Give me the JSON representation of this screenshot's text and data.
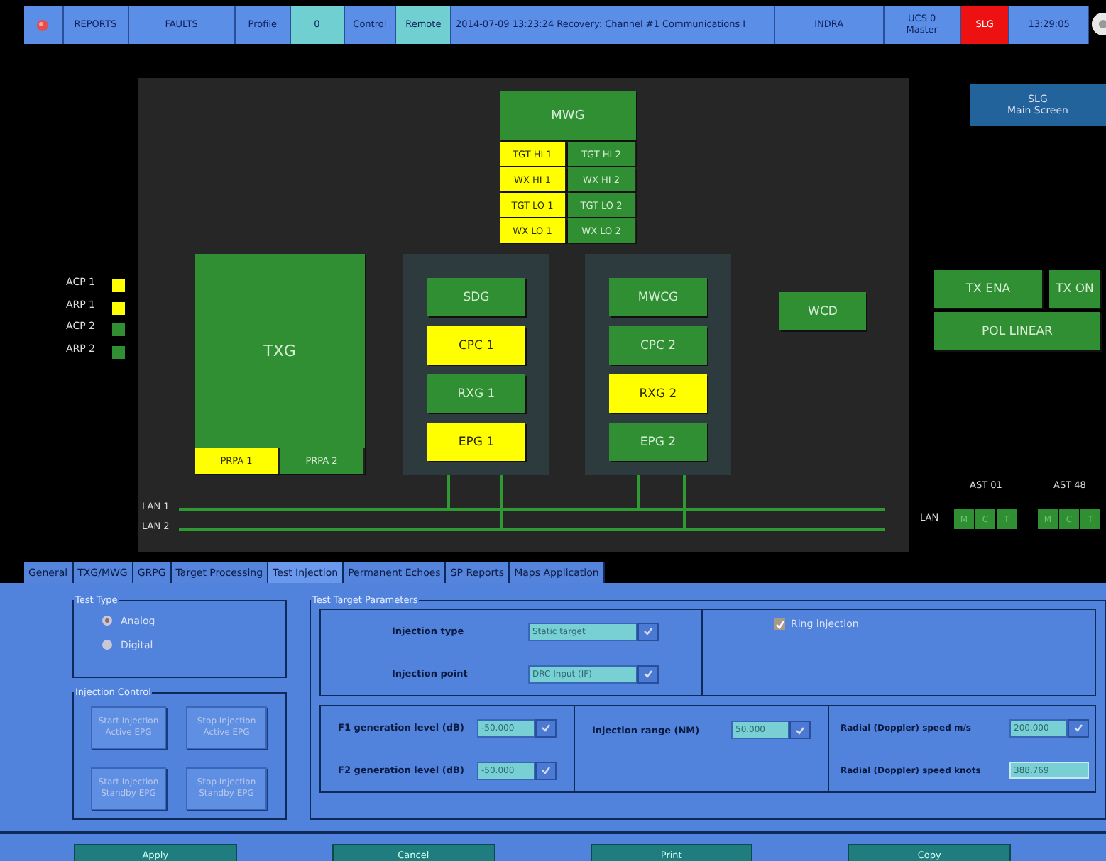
{
  "top_bar": [
    {
      "kind": "label",
      "text": "REPORTS",
      "color": "#5b8ee6"
    },
    {
      "kind": "label",
      "text": "FAULTS",
      "color": "#5b8ee6"
    },
    {
      "kind": "label",
      "text": "Profile",
      "color": "#5b8ee6"
    },
    {
      "kind": "label",
      "text": "0",
      "color": "#70cfd0"
    },
    {
      "kind": "label",
      "text": "Control",
      "color": "#5b8ee6"
    },
    {
      "kind": "label",
      "text": "Remote",
      "color": "#70cfd0"
    },
    {
      "kind": "message",
      "text": "2014-07-09 13:23:24 Recovery: Channel #1 Communications I",
      "color": "#5b8ee6"
    },
    {
      "kind": "label",
      "text": "INDRA",
      "color": "#5b8ee6"
    },
    {
      "kind": "label",
      "text": "UCS 0\nMaster",
      "color": "#5b8ee6"
    },
    {
      "kind": "label",
      "text": "SLG",
      "color": "#ee1111"
    },
    {
      "kind": "label",
      "text": "13:29:05",
      "color": "#5b8ee6"
    }
  ],
  "diagram": {
    "mwg": {
      "label": "MWG",
      "color": "#2f8f32"
    },
    "mwg_channels": [
      {
        "label": "TGT HI 1",
        "color": "#ffff00"
      },
      {
        "label": "TGT HI 2",
        "color": "#2f8f32"
      },
      {
        "label": "WX HI 1",
        "color": "#ffff00"
      },
      {
        "label": "WX HI 2",
        "color": "#2f8f32"
      },
      {
        "label": "TGT LO 1",
        "color": "#ffff00"
      },
      {
        "label": "TGT LO 2",
        "color": "#2f8f32"
      },
      {
        "label": "WX LO 1",
        "color": "#ffff00"
      },
      {
        "label": "WX LO 2",
        "color": "#2f8f32"
      }
    ],
    "legend": [
      {
        "label": "ACP 1",
        "color": "#ffff00"
      },
      {
        "label": "ARP 1",
        "color": "#ffff00"
      },
      {
        "label": "ACP 2",
        "color": "#2f8f32"
      },
      {
        "label": "ARP 2",
        "color": "#2f8f32"
      }
    ],
    "txg": {
      "label": "TXG",
      "color": "#2f8f32"
    },
    "prpa": [
      {
        "label": "PRPA 1",
        "color": "#ffff00"
      },
      {
        "label": "PRPA 2",
        "color": "#2f8f32"
      }
    ],
    "channels": [
      {
        "units": [
          {
            "label": "SDG",
            "color": "#2f8f32"
          },
          {
            "label": "CPC 1",
            "color": "#ffff00"
          },
          {
            "label": "RXG 1",
            "color": "#2f8f32"
          },
          {
            "label": "EPG 1",
            "color": "#ffff00"
          }
        ]
      },
      {
        "units": [
          {
            "label": "MWCG",
            "color": "#2f8f32"
          },
          {
            "label": "CPC 2",
            "color": "#2f8f32"
          },
          {
            "label": "RXG 2",
            "color": "#ffff00"
          },
          {
            "label": "EPG 2",
            "color": "#2f8f32"
          }
        ]
      }
    ],
    "wcd": {
      "label": "WCD",
      "color": "#2f8f32"
    },
    "lan_labels": [
      "LAN 1",
      "LAN 2"
    ]
  },
  "slg_button": "SLG\nMain Screen",
  "tx_status": [
    {
      "label": "TX ENA",
      "color": "#2f8f32"
    },
    {
      "label": "TX ON",
      "color": "#2f8f32"
    },
    {
      "label": "POL LINEAR",
      "color": "#2f8f32"
    }
  ],
  "ast": {
    "lan_label": "LAN",
    "stations": [
      {
        "label": "AST 01",
        "cells": [
          {
            "label": "M",
            "color": "#2f8f32"
          },
          {
            "label": "C",
            "color": "#2f8f32"
          },
          {
            "label": "T",
            "color": "#2f8f32"
          }
        ]
      },
      {
        "label": "AST 48",
        "cells": [
          {
            "label": "M",
            "color": "#2f8f32"
          },
          {
            "label": "C",
            "color": "#2f8f32"
          },
          {
            "label": "T",
            "color": "#2f8f32"
          }
        ]
      }
    ]
  },
  "tabs": [
    {
      "label": "General",
      "selected": false
    },
    {
      "label": "TXG/MWG",
      "selected": false
    },
    {
      "label": "GRPG",
      "selected": false
    },
    {
      "label": "Target Processing",
      "selected": false
    },
    {
      "label": "Test Injection",
      "selected": true
    },
    {
      "label": "Permanent Echoes",
      "selected": false
    },
    {
      "label": "SP Reports",
      "selected": false
    },
    {
      "label": "Maps Application",
      "selected": false
    }
  ],
  "test_type": {
    "title": "Test Type",
    "options": [
      {
        "label": "Analog",
        "selected": true
      },
      {
        "label": "Digital",
        "selected": false
      }
    ]
  },
  "injection_control": {
    "title": "Injection Control",
    "buttons": [
      {
        "label": "Start Injection\nActive EPG",
        "disabled": true
      },
      {
        "label": "Stop Injection\nActive EPG",
        "disabled": true
      },
      {
        "label": "Start Injection\nStandby EPG",
        "disabled": true
      },
      {
        "label": "Stop Injection\nStandby EPG",
        "disabled": true
      }
    ]
  },
  "test_target": {
    "title": "Test Target Parameters",
    "injection": [
      {
        "label": "Injection type",
        "value": "Static target"
      },
      {
        "label": "Injection point",
        "value": "DRC Input (IF)"
      }
    ],
    "ring_injection": {
      "label": "Ring injection",
      "checked": true
    },
    "columns": [
      {
        "fields": [
          {
            "kind": "combo",
            "label": "F1 generation level (dB)",
            "value": "-50.000"
          },
          {
            "kind": "combo",
            "label": "F2 generation level (dB)",
            "value": "-50.000"
          }
        ]
      },
      {
        "fields": [
          {
            "kind": "combo",
            "label": "Injection range (NM)",
            "value": "50.000"
          }
        ]
      },
      {
        "fields": [
          {
            "kind": "combo",
            "label": "Radial (Doppler) speed m/s",
            "value": "200.000"
          },
          {
            "kind": "text",
            "label": "Radial (Doppler) speed knots",
            "value": "388.769"
          }
        ]
      }
    ]
  },
  "footer_buttons": [
    "Apply",
    "Cancel",
    "Print",
    "Copy"
  ]
}
